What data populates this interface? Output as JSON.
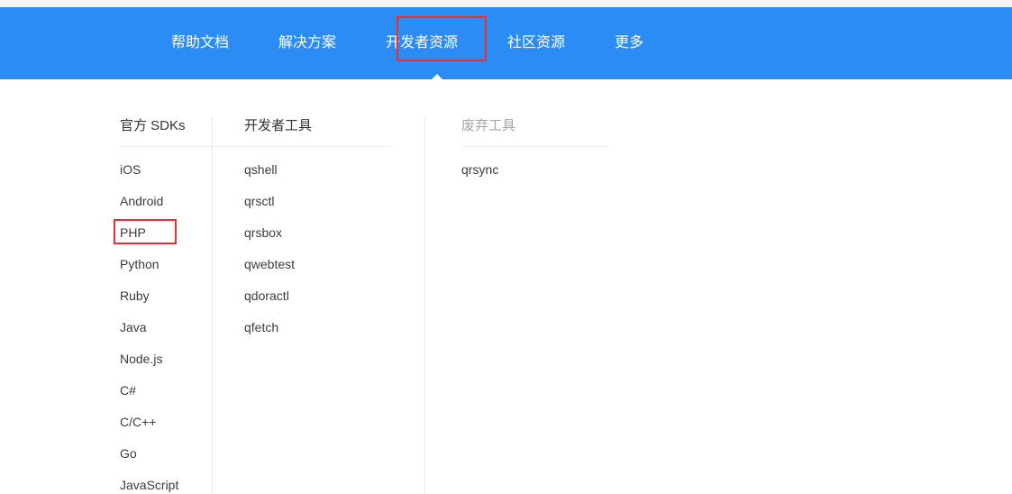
{
  "navbar": {
    "background_color": "#2b8cf5",
    "items": [
      {
        "label": "帮助文档",
        "name": "nav-item-help-docs",
        "active": false
      },
      {
        "label": "解决方案",
        "name": "nav-item-solutions",
        "active": false
      },
      {
        "label": "开发者资源",
        "name": "nav-item-developer-resources",
        "active": true
      },
      {
        "label": "社区资源",
        "name": "nav-item-community-resources",
        "active": false
      },
      {
        "label": "更多",
        "name": "nav-item-more",
        "active": false
      }
    ]
  },
  "annotations": {
    "highlight_color": "#ee2d2d",
    "nav_highlight_target": "开发者资源",
    "item_highlight_target": "PHP"
  },
  "dropdown": {
    "columns": [
      {
        "header": "官方 SDKs",
        "header_muted": false,
        "items": [
          "iOS",
          "Android",
          "PHP",
          "Python",
          "Ruby",
          "Java",
          "Node.js",
          "C#",
          "C/C++",
          "Go",
          "JavaScript"
        ]
      },
      {
        "header": "开发者工具",
        "header_muted": false,
        "items": [
          "qshell",
          "qrsctl",
          "qrsbox",
          "qwebtest",
          "qdoractl",
          "qfetch"
        ]
      },
      {
        "header": "废弃工具",
        "header_muted": true,
        "items": [
          "qrsync"
        ]
      }
    ]
  }
}
